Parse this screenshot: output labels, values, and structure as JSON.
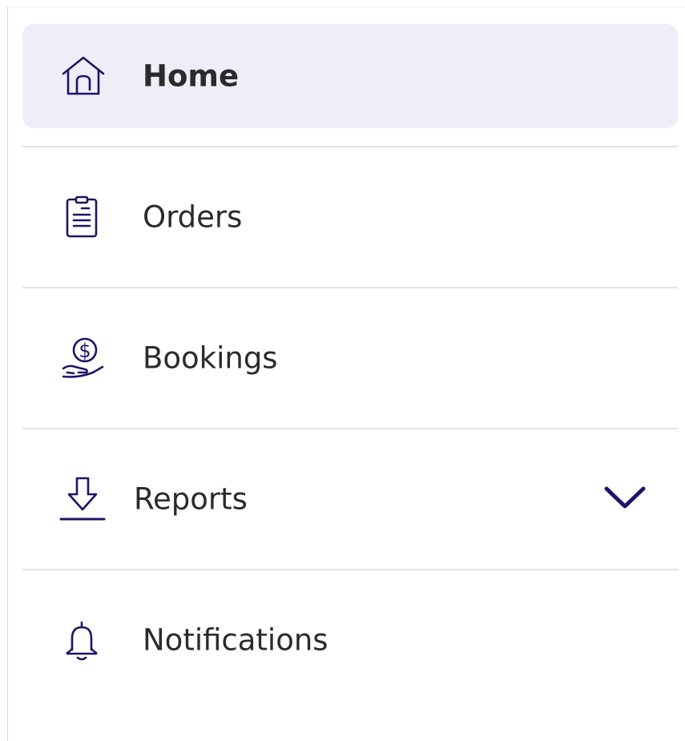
{
  "theme": {
    "accent": "#1e1466",
    "active_bg": "#efeef8",
    "divider": "#e3e3e3",
    "text": "#2b2b2b"
  },
  "nav": {
    "items": [
      {
        "label": "Home",
        "icon": "home-icon",
        "active": true
      },
      {
        "label": "Orders",
        "icon": "document-icon",
        "active": false
      },
      {
        "label": "Bookings",
        "icon": "dollar-hand-icon",
        "active": false
      },
      {
        "label": "Reports",
        "icon": "download-icon",
        "active": false,
        "expandable": true,
        "expanded": false,
        "chevron_icon": "chevron-down-icon"
      },
      {
        "label": "Notifications",
        "icon": "bell-icon",
        "active": false
      }
    ]
  }
}
